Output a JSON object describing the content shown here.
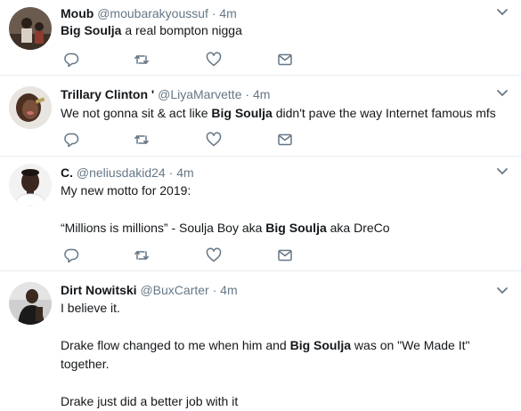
{
  "tweets": [
    {
      "name": "Moub",
      "handle": "@moubarakyoussuf",
      "dot": "·",
      "time": "4m",
      "lines": [
        {
          "pre": "",
          "bold": "Big Soulja",
          "post": " a real bompton nigga"
        }
      ]
    },
    {
      "name": "Trillary Clinton '",
      "handle": "@LiyaMarvette",
      "dot": "·",
      "time": "4m",
      "lines": [
        {
          "pre": "We not gonna sit & act like ",
          "bold": "Big Soulja",
          "post": " didn't pave the way Internet famous mfs"
        }
      ]
    },
    {
      "name": "C.",
      "handle": "@neliusdakid24",
      "dot": "·",
      "time": "4m",
      "lines": [
        {
          "pre": "My new motto for 2019:",
          "bold": "",
          "post": ""
        },
        {
          "pre": "“Millions is millions” - Soulja Boy aka ",
          "bold": "Big Soulja",
          "post": " aka DreCo"
        }
      ]
    },
    {
      "name": "Dirt Nowitski",
      "handle": "@BuxCarter",
      "dot": "·",
      "time": "4m",
      "lines": [
        {
          "pre": "I believe it.",
          "bold": "",
          "post": ""
        },
        {
          "pre": "Drake flow changed to me when him and ",
          "bold": "Big Soulja",
          "post": " was on \"We Made It\""
        },
        {
          "pre": "together.",
          "bold": "",
          "post": ""
        },
        {
          "pre": "Drake just did a better job with it",
          "bold": "",
          "post": ""
        }
      ]
    }
  ],
  "icons": {
    "reply": "reply-icon",
    "retweet": "retweet-icon",
    "like": "heart-icon",
    "message": "direct-message-icon",
    "more": "chevron-down-icon"
  },
  "colors": {
    "name": "#14171a",
    "meta": "#657786",
    "border": "#e6ecf0"
  }
}
